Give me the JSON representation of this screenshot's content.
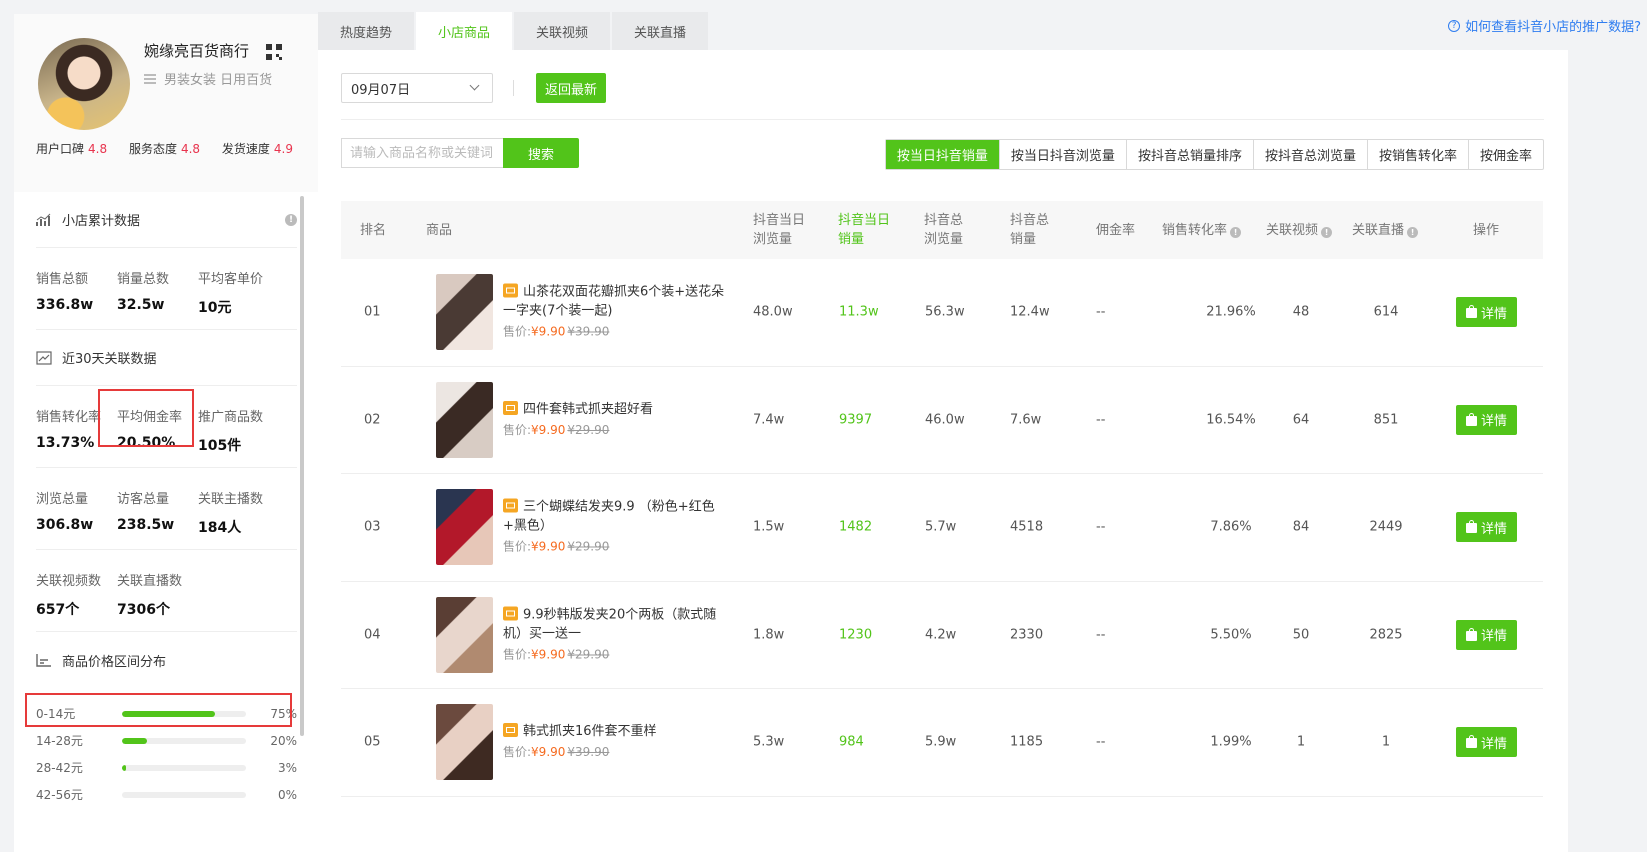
{
  "shop": {
    "name": "婉缘亮百货商行",
    "categories": "男装女装 日用百货",
    "ratings": [
      {
        "label": "用户口碑",
        "value": "4.8"
      },
      {
        "label": "服务态度",
        "value": "4.8"
      },
      {
        "label": "发货速度",
        "value": "4.9"
      }
    ]
  },
  "stats": {
    "cumulative_title": "小店累计数据",
    "cumulative": [
      {
        "label": "销售总额",
        "value": "336.8w"
      },
      {
        "label": "销量总数",
        "value": "32.5w"
      },
      {
        "label": "平均客单价",
        "value": "10元"
      }
    ],
    "recent_title": "近30天关联数据",
    "recent_row1": [
      {
        "label": "销售转化率",
        "value": "13.73%"
      },
      {
        "label": "平均佣金率",
        "value": "20.50%"
      },
      {
        "label": "推广商品数",
        "value": "105件"
      }
    ],
    "recent_row2": [
      {
        "label": "浏览总量",
        "value": "306.8w"
      },
      {
        "label": "访客总量",
        "value": "238.5w"
      },
      {
        "label": "关联主播数",
        "value": "184人"
      }
    ],
    "recent_row3": [
      {
        "label": "关联视频数",
        "value": "657个"
      },
      {
        "label": "关联直播数",
        "value": "7306个"
      }
    ],
    "price_title": "商品价格区间分布",
    "price_dist": [
      {
        "range": "0-14元",
        "pct": "75%",
        "fraction": 0.75
      },
      {
        "range": "14-28元",
        "pct": "20%",
        "fraction": 0.2
      },
      {
        "range": "28-42元",
        "pct": "3%",
        "fraction": 0.03
      },
      {
        "range": "42-56元",
        "pct": "0%",
        "fraction": 0.0
      }
    ]
  },
  "tabs": [
    "热度趋势",
    "小店商品",
    "关联视频",
    "关联直播"
  ],
  "active_tab": 1,
  "help_link": "如何查看抖音小店的推广数据?",
  "toolbar": {
    "date": "09月07日",
    "latest_label": "返回最新",
    "search_placeholder": "请输入商品名称或关键词",
    "search_label": "搜索",
    "sorts": [
      "按当日抖音销量",
      "按当日抖音浏览量",
      "按抖音总销量排序",
      "按抖音总浏览量",
      "按销售转化率",
      "按佣金率"
    ],
    "active_sort": 0
  },
  "table": {
    "headers": {
      "rank": "排名",
      "product": "商品",
      "day_views_1": "抖音当日",
      "day_views_2": "浏览量",
      "day_sales_1": "抖音当日",
      "day_sales_2": "销量",
      "total_views_1": "抖音总",
      "total_views_2": "浏览量",
      "total_sales_1": "抖音总",
      "total_sales_2": "销量",
      "commission": "佣金率",
      "conversion": "销售转化率",
      "videos": "关联视频",
      "lives": "关联直播",
      "action": "操作"
    },
    "price_prefix": "售价:",
    "detail_label": "详情",
    "rows": [
      {
        "rank": "01",
        "name": "山茶花双面花瓣抓夹6个装+送花朵一字夹(7个装一起)",
        "price": "¥9.90",
        "orig": "¥39.90",
        "day_views": "48.0w",
        "day_sales": "11.3w",
        "total_views": "56.3w",
        "total_sales": "12.4w",
        "commission": "--",
        "conversion": "21.96%",
        "videos": "48",
        "lives": "614",
        "thumb": [
          "#d9c9c0",
          "#4a3a34",
          "#f1e6e0"
        ]
      },
      {
        "rank": "02",
        "name": "四件套韩式抓夹超好看",
        "price": "¥9.90",
        "orig": "¥29.90",
        "day_views": "7.4w",
        "day_sales": "9397",
        "total_views": "46.0w",
        "total_sales": "7.6w",
        "commission": "--",
        "conversion": "16.54%",
        "videos": "64",
        "lives": "851",
        "thumb": [
          "#ece6e2",
          "#3a2a24",
          "#d8ccc4"
        ]
      },
      {
        "rank": "03",
        "name": "三个蝴蝶结发夹9.9 （粉色+红色+黑色）",
        "price": "¥9.90",
        "orig": "¥29.90",
        "day_views": "1.5w",
        "day_sales": "1482",
        "total_views": "5.7w",
        "total_sales": "4518",
        "commission": "--",
        "conversion": "7.86%",
        "videos": "84",
        "lives": "2449",
        "thumb": [
          "#2a3550",
          "#b3182a",
          "#e7c7b8"
        ]
      },
      {
        "rank": "04",
        "name": "9.9秒韩版发夹20个两板（款式随机）买一送一",
        "price": "¥9.90",
        "orig": "¥29.90",
        "day_views": "1.8w",
        "day_sales": "1230",
        "total_views": "4.2w",
        "total_sales": "2330",
        "commission": "--",
        "conversion": "5.50%",
        "videos": "50",
        "lives": "2825",
        "thumb": [
          "#5a3e34",
          "#e8d6cc",
          "#b08a70"
        ]
      },
      {
        "rank": "05",
        "name": "韩式抓夹16件套不重样",
        "price": "¥9.90",
        "orig": "¥39.90",
        "day_views": "5.3w",
        "day_sales": "984",
        "total_views": "5.9w",
        "total_sales": "1185",
        "commission": "--",
        "conversion": "1.99%",
        "videos": "1",
        "lives": "1",
        "thumb": [
          "#6b4a3e",
          "#e8d0c4",
          "#3e2a22"
        ]
      }
    ]
  },
  "colors": {
    "accent": "#52c41a",
    "price": "#f56a1f",
    "rating": "#e8344e",
    "link": "#2f7df0",
    "highlight": "#e63a3a"
  }
}
